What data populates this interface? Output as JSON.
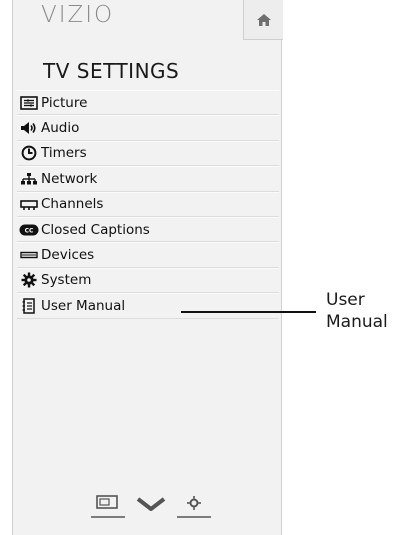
{
  "brand": "VIZIO",
  "menu_title": "TV SETTINGS",
  "menu": [
    {
      "label": "Picture",
      "icon": "picture-icon"
    },
    {
      "label": "Audio",
      "icon": "speaker-icon"
    },
    {
      "label": "Timers",
      "icon": "clock-icon"
    },
    {
      "label": "Network",
      "icon": "network-icon"
    },
    {
      "label": "Channels",
      "icon": "antenna-icon"
    },
    {
      "label": "Closed Captions",
      "icon": "cc-icon"
    },
    {
      "label": "Devices",
      "icon": "device-icon"
    },
    {
      "label": "System",
      "icon": "gear-icon"
    },
    {
      "label": "User Manual",
      "icon": "manual-icon"
    }
  ],
  "callout": {
    "line1": "User",
    "line2": "Manual"
  },
  "colors": {
    "panel_bg": "#f2f2f2",
    "brand_gray": "#8a8a8a",
    "text": "#111111"
  }
}
